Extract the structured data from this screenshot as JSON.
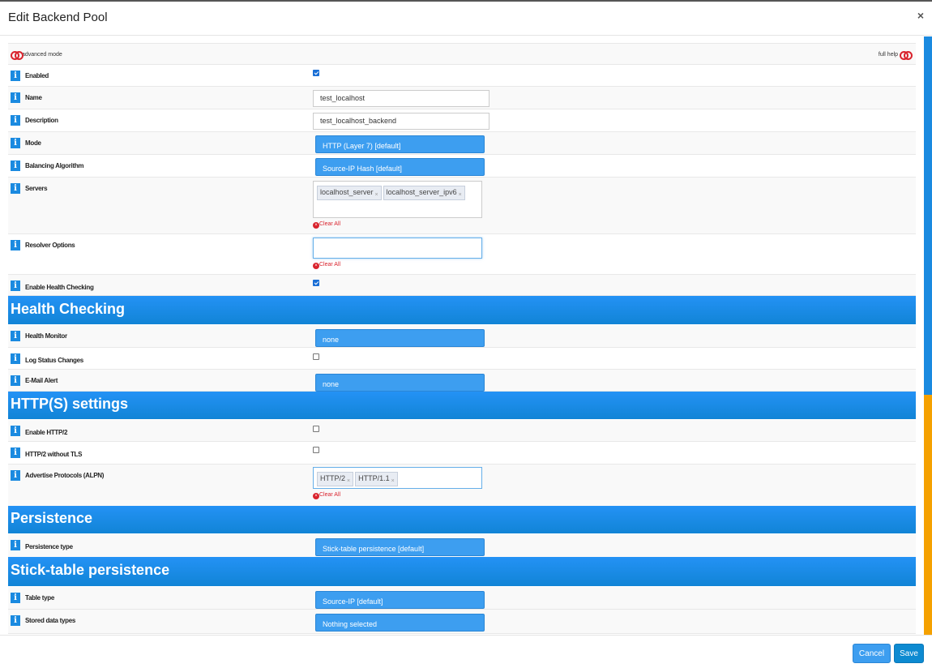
{
  "dialog": {
    "title": "Edit Backend Pool",
    "close_icon": "×"
  },
  "topbar": {
    "advanced_mode_label": "advanced mode",
    "full_help_label": "full help"
  },
  "fields": {
    "enabled": {
      "label": "Enabled",
      "checked": true
    },
    "name": {
      "label": "Name",
      "value": "test_localhost"
    },
    "description": {
      "label": "Description",
      "value": "test_localhost_backend"
    },
    "mode": {
      "label": "Mode",
      "selected": "HTTP (Layer 7) [default]"
    },
    "balancing": {
      "label": "Balancing Algorithm",
      "selected": "Source-IP Hash [default]"
    },
    "servers": {
      "label": "Servers",
      "tags": [
        "localhost_server",
        "localhost_server_ipv6"
      ],
      "clear_label": "Clear All"
    },
    "resolver": {
      "label": "Resolver Options",
      "value": "",
      "clear_label": "Clear All"
    },
    "enable_health": {
      "label": "Enable Health Checking",
      "checked": true
    }
  },
  "sections": {
    "health": "Health Checking",
    "https": "HTTP(S) settings",
    "persistence": "Persistence",
    "sticktable": "Stick-table persistence"
  },
  "health": {
    "monitor": {
      "label": "Health Monitor",
      "selected": "none"
    },
    "log_status": {
      "label": "Log Status Changes",
      "checked": false
    },
    "email_alert": {
      "label": "E-Mail Alert",
      "selected": "none"
    }
  },
  "https": {
    "enable_http2": {
      "label": "Enable HTTP/2",
      "checked": false
    },
    "http2_no_tls": {
      "label": "HTTP/2 without TLS",
      "checked": false
    },
    "alpn": {
      "label": "Advertise Protocols (ALPN)",
      "tags": [
        "HTTP/2",
        "HTTP/1.1"
      ],
      "clear_label": "Clear All"
    }
  },
  "persistence": {
    "type": {
      "label": "Persistence type",
      "selected": "Stick-table persistence [default]"
    }
  },
  "sticktable": {
    "table_type": {
      "label": "Table type",
      "selected": "Source-IP [default]"
    },
    "stored_types": {
      "label": "Stored data types",
      "selected": "Nothing selected"
    }
  },
  "footer": {
    "cancel_label": "Cancel",
    "save_label": "Save"
  },
  "tag_remove_glyph": "×",
  "info_glyph": "i",
  "clear_glyph": "×",
  "colors": {
    "accent": "#1a8ae0",
    "select": "#3d9ef0",
    "danger": "#d9232d",
    "scroll_thumb": "#f5a100"
  }
}
